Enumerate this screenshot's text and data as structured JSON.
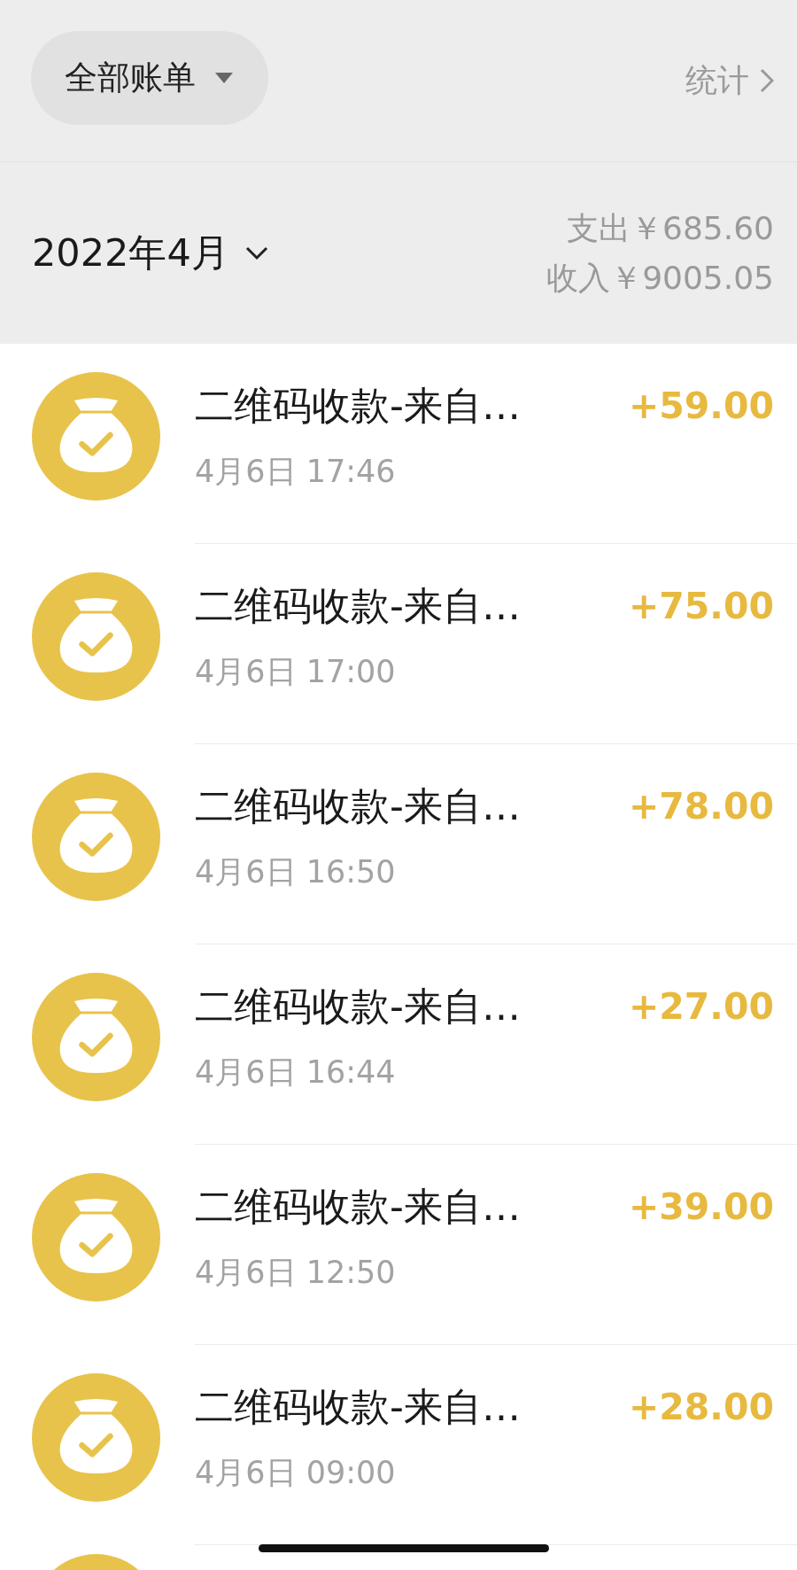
{
  "filter_button": {
    "label": "全部账单"
  },
  "stats_link": {
    "label": "统计"
  },
  "month": {
    "label": "2022年4月",
    "expense": "支出￥685.60",
    "income": "收入￥9005.05"
  },
  "transactions": [
    {
      "title": "二维码收款-来自…",
      "time": "4月6日 17:46",
      "amount": "+59.00"
    },
    {
      "title": "二维码收款-来自…",
      "time": "4月6日 17:00",
      "amount": "+75.00"
    },
    {
      "title": "二维码收款-来自…",
      "time": "4月6日 16:50",
      "amount": "+78.00"
    },
    {
      "title": "二维码收款-来自…",
      "time": "4月6日 16:44",
      "amount": "+27.00"
    },
    {
      "title": "二维码收款-来自…",
      "time": "4月6日 12:50",
      "amount": "+39.00"
    },
    {
      "title": "二维码收款-来自…",
      "time": "4月6日 09:00",
      "amount": "+28.00"
    }
  ]
}
